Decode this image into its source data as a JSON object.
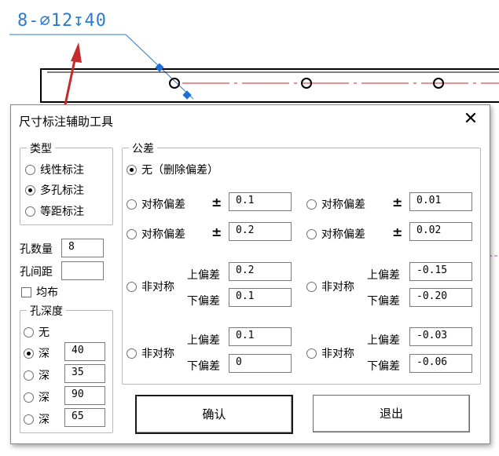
{
  "cad": {
    "dimension_text": "8-⌀12↧40",
    "colors": {
      "dimension": "#2b7bd0",
      "centerline": "#cc2222",
      "arrow": "#c62a2a",
      "guide": "#cc44aa"
    }
  },
  "dialog": {
    "title": "尺寸标注辅助工具",
    "close_label": "✕",
    "type_group": {
      "title": "类型",
      "options": [
        "线性标注",
        "多孔标注",
        "等距标注"
      ],
      "selected_index": 1
    },
    "hole_count": {
      "label": "孔数量",
      "value": "8"
    },
    "hole_spacing": {
      "label": "孔间距",
      "value": ""
    },
    "even_distribute": {
      "label": "均布",
      "checked": false
    },
    "depth_group": {
      "title": "孔深度",
      "none_label": "无",
      "deep_label": "深",
      "values": [
        "40",
        "35",
        "90",
        "65"
      ],
      "selected_index": 1
    },
    "tolerance_group": {
      "title": "公差",
      "none_label": "无（删除偏差）",
      "symmetric_label": "对称偏差",
      "asymmetric_label": "非对称",
      "plus_minus": "±",
      "upper_label": "上偏差",
      "lower_label": "下偏差",
      "symmetric_values": [
        "0.1",
        "0.01",
        "0.2",
        "0.02"
      ],
      "asym_1": {
        "upper": "0.2",
        "lower": "0.1"
      },
      "asym_2": {
        "upper": "-0.15",
        "lower": "-0.20"
      },
      "asym_3": {
        "upper": "0.1",
        "lower": "0"
      },
      "asym_4": {
        "upper": "-0.03",
        "lower": "-0.06"
      }
    },
    "confirm_label": "确认",
    "exit_label": "退出"
  }
}
